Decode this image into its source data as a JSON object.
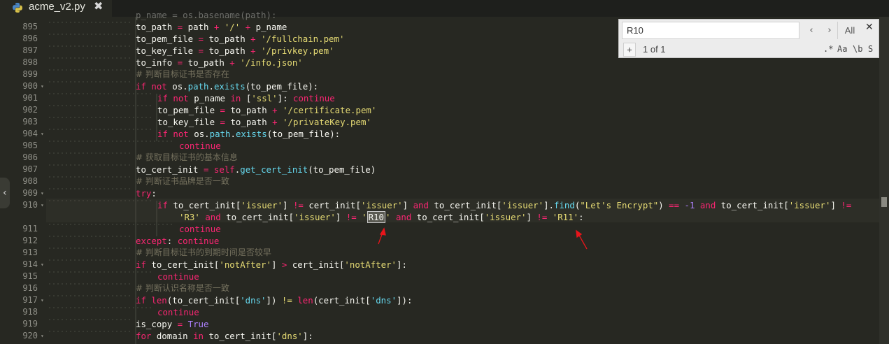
{
  "tab": {
    "filename": "acme_v2.py",
    "icon": "python-icon",
    "close_glyph": "✖"
  },
  "search": {
    "query": "R10",
    "prev_glyph": "‹",
    "next_glyph": "›",
    "all_label": "All",
    "close_glyph": "✕",
    "plus_label": "+",
    "count": "1 of 1",
    "opt_regex": ".*",
    "opt_case": "Aa",
    "opt_word": "\\b",
    "opt_selection": "S"
  },
  "gutter": {
    "numbers": [
      "895",
      "896",
      "897",
      "898",
      "899",
      "900",
      "901",
      "902",
      "903",
      "904",
      "905",
      "906",
      "907",
      "908",
      "909",
      "910",
      "911",
      "912",
      "913",
      "914",
      "915",
      "916",
      "917",
      "918",
      "919",
      "920"
    ]
  },
  "code": {
    "l894": "p_name = os.basename(path):",
    "l895": [
      "to_path",
      " = ",
      "path",
      " + ",
      "'/'",
      " + ",
      "p_name"
    ],
    "l896": [
      "to_pem_file",
      " = ",
      "to_path",
      " + ",
      "'/fullchain.pem'"
    ],
    "l897": [
      "to_key_file",
      " = ",
      "to_path",
      " + ",
      "'/privkey.pem'"
    ],
    "l898": [
      "to_info",
      " = ",
      "to_path",
      " + ",
      "'/info.json'"
    ],
    "l899": "# 判断目标证书是否存在",
    "l900": [
      "if",
      " ",
      "not",
      " os.",
      "path",
      ".",
      "exists",
      "(to_pem_file):"
    ],
    "l901": [
      "if",
      " ",
      "not",
      " p_name ",
      "in",
      " [",
      "'ssl'",
      "]: ",
      "continue"
    ],
    "l902": [
      "to_pem_file",
      " = ",
      "to_path",
      " + ",
      "'/certificate.pem'"
    ],
    "l903": [
      "to_key_file",
      " = ",
      "to_path",
      " + ",
      "'/privateKey.pem'"
    ],
    "l904": [
      "if",
      " ",
      "not",
      " os.",
      "path",
      ".",
      "exists",
      "(to_pem_file):"
    ],
    "l905": "continue",
    "l906": "# 获取目标证书的基本信息",
    "l907": [
      "to_cert_init",
      " = ",
      "self",
      ".",
      "get_cert_init",
      "(to_pem_file)"
    ],
    "l908": "# 判断证书品牌是否一致",
    "l909": [
      "try",
      ":"
    ],
    "l910a": [
      "if",
      " to_cert_init[",
      "'issuer'",
      "] ",
      "!=",
      " cert_init[",
      "'issuer'",
      "] ",
      "and",
      " to_cert_init[",
      "'issuer'",
      "].",
      "find",
      "(",
      "\"Let's Encrypt\"",
      ") ",
      "==",
      " ",
      "-1",
      " ",
      "and",
      " to_cert_init[",
      "'issuer'",
      "] ",
      "!="
    ],
    "l910b": [
      "'R3'",
      " ",
      "and",
      " to_cert_init[",
      "'issuer'",
      "] ",
      "!=",
      " ",
      "'",
      "R10",
      "'",
      " ",
      "and",
      " to_cert_init[",
      "'issuer'",
      "] ",
      "!=",
      " ",
      "'R11'",
      ":"
    ],
    "l911": "continue",
    "l912": [
      "except",
      ": ",
      "continue"
    ],
    "l913": "# 判断目标证书的到期时间是否较早",
    "l914": [
      "if",
      " to_cert_init[",
      "'notAfter'",
      "] ",
      ">",
      " cert_init[",
      "'notAfter'",
      "]:"
    ],
    "l915": "continue",
    "l916": "# 判断认识名称是否一致",
    "l917": [
      "if",
      " ",
      "len",
      "(to_cert_init[",
      "'dns'",
      "]) ",
      "!=",
      " ",
      "len",
      "(cert_init[",
      "'dns'",
      "]):"
    ],
    "l918": "continue",
    "l919": [
      "is_copy",
      " = ",
      "True"
    ],
    "l920": [
      "for",
      " domain ",
      "in",
      " to_cert_init[",
      "'dns'",
      "]:"
    ]
  },
  "colors": {
    "background": "#272822",
    "keyword": "#f92672",
    "string": "#e6db74",
    "function": "#66d9ef",
    "comment": "#75715e",
    "number": "#ae81ff",
    "annotation_arrow": "#e8151b"
  }
}
